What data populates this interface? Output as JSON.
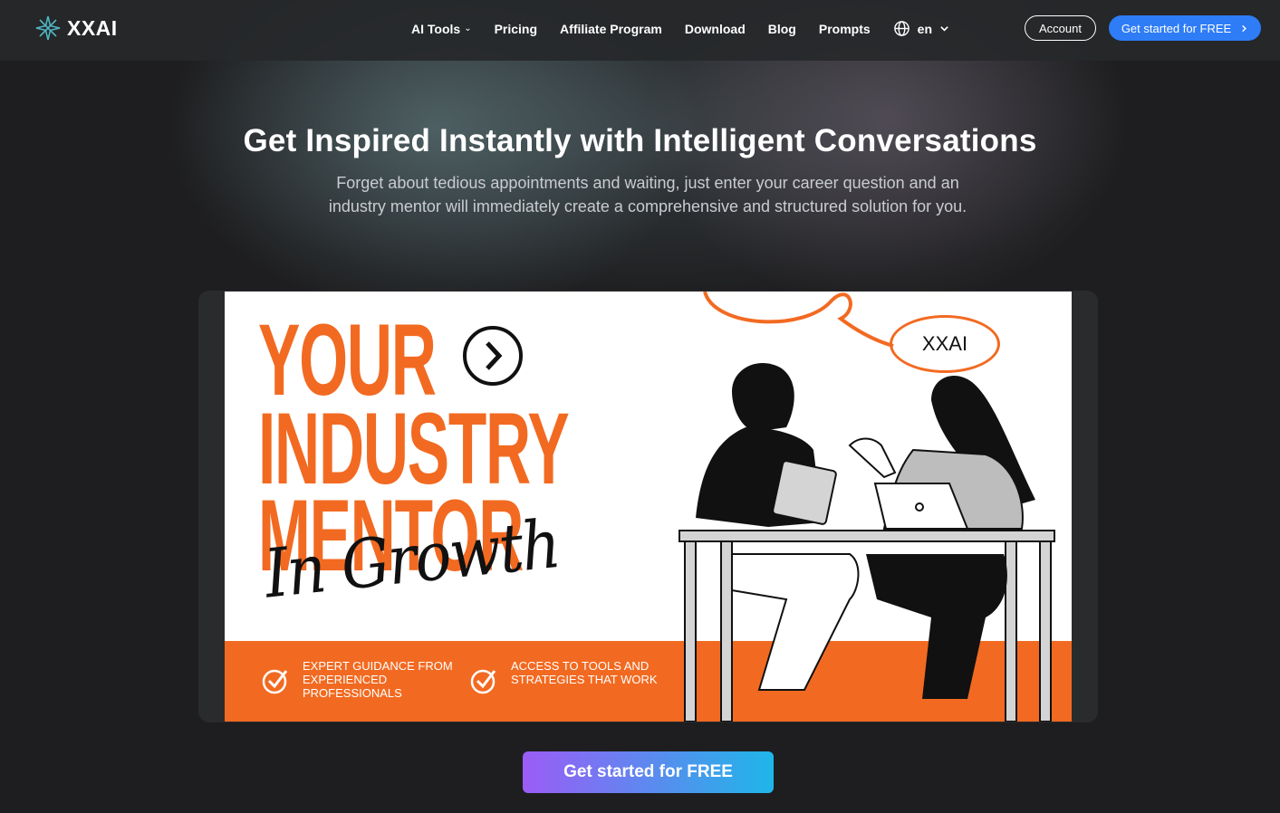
{
  "header": {
    "logo_text": "XXAI",
    "nav": [
      {
        "label": "AI Tools",
        "has_dropdown": true
      },
      {
        "label": "Pricing"
      },
      {
        "label": "Affiliate Program"
      },
      {
        "label": "Download"
      },
      {
        "label": "Blog"
      },
      {
        "label": "Prompts"
      }
    ],
    "language": "en",
    "account_label": "Account",
    "get_started_label": "Get started for FREE"
  },
  "hero": {
    "title": "Get Inspired Instantly with Intelligent Conversations",
    "subtitle": "Forget about tedious appointments and waiting, just enter your career question and an industry mentor will immediately create a comprehensive and structured solution for you."
  },
  "banner": {
    "headline_line1": "YOUR",
    "headline_line2": "INDUSTRY",
    "headline_line3": "MENTOR",
    "script_text": "In Growth",
    "bubble_text": "XXAI",
    "features": [
      "EXPERT GUIDANCE FROM EXPERIENCED PROFESSIONALS",
      "ACCESS TO TOOLS AND STRATEGIES THAT WORK"
    ]
  },
  "cta": {
    "label": "Get started for FREE"
  },
  "colors": {
    "accent_orange": "#f26a21",
    "button_blue": "#2e7cf6",
    "cta_gradient_start": "#9b5cf6",
    "cta_gradient_end": "#1fb6e8"
  }
}
